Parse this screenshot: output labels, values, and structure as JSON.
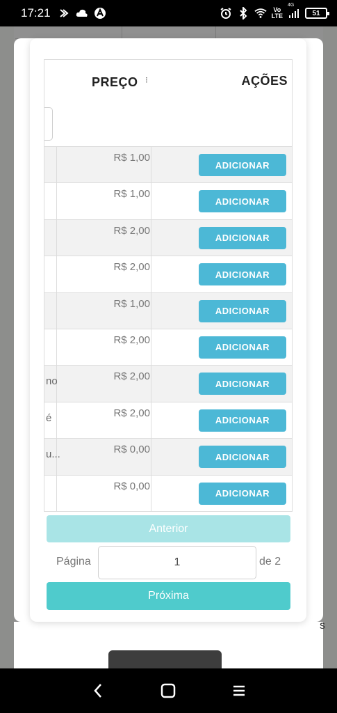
{
  "status_bar": {
    "time": "17:21",
    "left_icons": [
      "data-saver-icon",
      "cloud-icon",
      "app-notification-icon"
    ],
    "right_icons": [
      "alarm-icon",
      "bluetooth-icon",
      "wifi-icon",
      "volte-icon",
      "signal-icon",
      "battery-icon"
    ],
    "volte_line1": "Vo",
    "volte_line2": "LTE",
    "network": "4G",
    "battery": "51"
  },
  "table": {
    "columns": {
      "price": "PREÇO",
      "sort_indicator": "⁝",
      "actions": "AÇÕES"
    },
    "rows": [
      {
        "left_text": "",
        "price": "R$ 1,00",
        "action": "ADICIONAR"
      },
      {
        "left_text": "",
        "price": "R$ 1,00",
        "action": "ADICIONAR"
      },
      {
        "left_text": "",
        "price": "R$ 2,00",
        "action": "ADICIONAR"
      },
      {
        "left_text": "",
        "price": "R$ 2,00",
        "action": "ADICIONAR"
      },
      {
        "left_text": "",
        "price": "R$ 1,00",
        "action": "ADICIONAR"
      },
      {
        "left_text": "",
        "price": "R$ 2,00",
        "action": "ADICIONAR"
      },
      {
        "left_text": "no",
        "price": "R$ 2,00",
        "action": "ADICIONAR"
      },
      {
        "left_text": "é",
        "price": "R$ 2,00",
        "action": "ADICIONAR"
      },
      {
        "left_text": "u...",
        "price": "R$ 0,00",
        "action": "ADICIONAR"
      },
      {
        "left_text": "",
        "price": "R$ 0,00",
        "action": "ADICIONAR"
      }
    ]
  },
  "pagination": {
    "prev_label": "Anterior",
    "page_label": "Página",
    "page_value": "1",
    "total_label": "de 2",
    "next_label": "Próxima"
  },
  "background": {
    "side_char": "s"
  },
  "colors": {
    "add_button": "#4cb8d6",
    "prev_button": "#a9e4e6",
    "next_button": "#4fcbcc"
  },
  "nav_bar": {
    "icons": [
      "back-icon",
      "home-icon",
      "menu-icon"
    ]
  }
}
